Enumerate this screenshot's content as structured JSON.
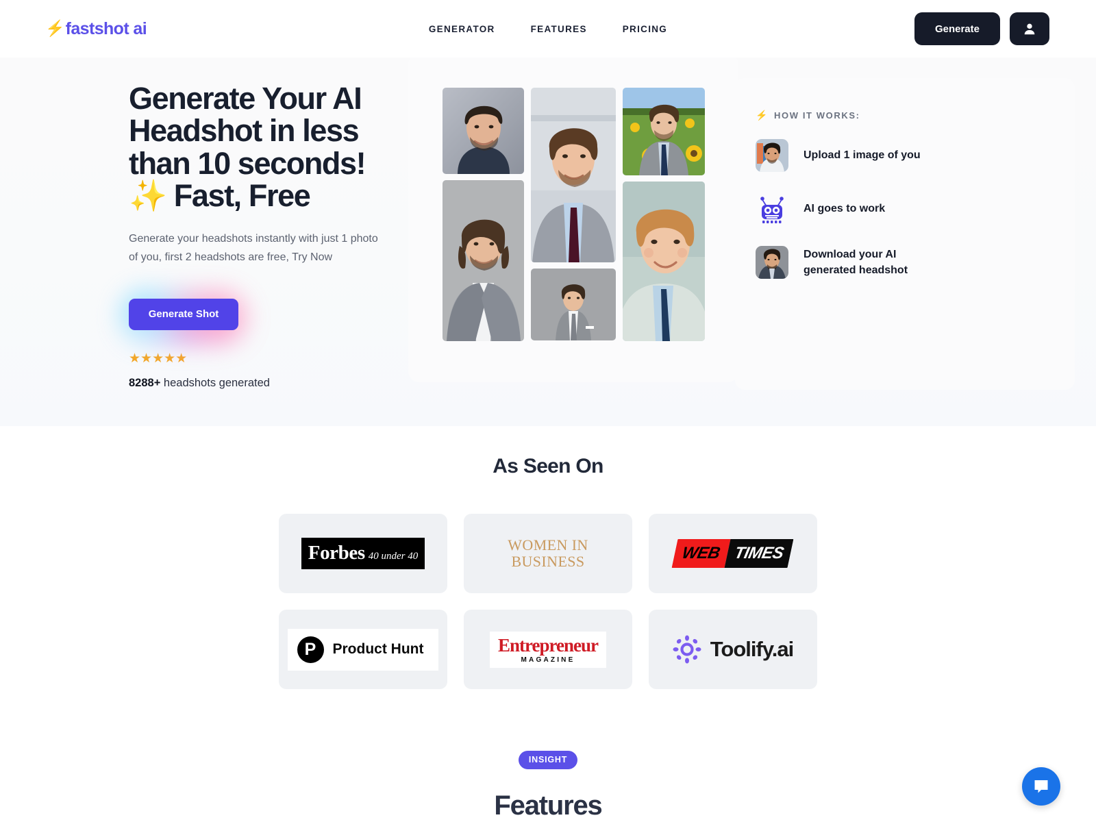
{
  "header": {
    "logo_bolt": "⚡",
    "logo_text": "fastshot ai",
    "nav": [
      {
        "label": "GENERATOR"
      },
      {
        "label": "FEATURES"
      },
      {
        "label": "PRICING"
      }
    ],
    "generate_label": "Generate",
    "account_icon": "person-icon",
    "button_bg": "#161b29"
  },
  "hero": {
    "title": "Generate Your AI Headshot in less than 10 seconds! ✨ Fast, Free",
    "subtitle": "Generate your headshots instantly with just 1 photo of you, first 2 headshots are free, Try Now",
    "cta_label": "Generate Shot",
    "cta_bg": "#5143e8",
    "stars": "★★★★★",
    "star_color": "#f5a623",
    "count_bold": "8288+",
    "count_rest": " headshots generated"
  },
  "how_it_works": {
    "bolt": "⚡",
    "heading": "HOW IT WORKS:",
    "steps": [
      {
        "label": "Upload 1 image of you",
        "icon": "photo-thumbnail"
      },
      {
        "label": "AI goes to work",
        "icon": "robot-icon"
      },
      {
        "label": "Download your AI generated headshot",
        "icon": "photo-thumbnail"
      }
    ]
  },
  "collage": {
    "alt": "AI generated headshot collage of six men in suits"
  },
  "as_seen_on": {
    "title": "As Seen On",
    "logos": [
      {
        "name": "Forbes",
        "main": "Forbes",
        "sub": "40 under 40"
      },
      {
        "name": "Women In Business",
        "line1": "WOMEN IN",
        "line2": "BUSINESS"
      },
      {
        "name": "Web Times",
        "part1": "WEB",
        "part2": "TIMES"
      },
      {
        "name": "Product Hunt",
        "mark": "P",
        "text": "Product Hunt"
      },
      {
        "name": "Entrepreneur Magazine",
        "main": "Entrepreneur",
        "sub": "MAGAZINE"
      },
      {
        "name": "Toolify.ai",
        "text": "Toolify.ai"
      }
    ]
  },
  "insight": {
    "badge": "INSIGHT",
    "badge_bg": "#5b50e8",
    "title": "Features"
  },
  "chat": {
    "icon": "chat-bubble-icon",
    "color": "#1a73e8"
  }
}
